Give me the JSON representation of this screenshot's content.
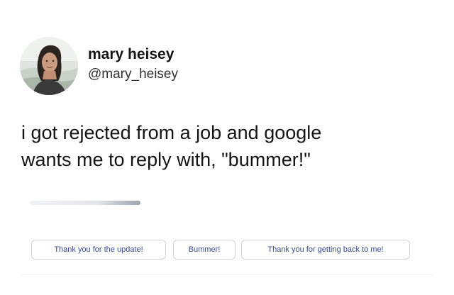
{
  "tweet": {
    "author": {
      "display_name": "mary heisey",
      "handle": "@mary_heisey",
      "avatar_icon": "profile-photo"
    },
    "text_lines": [
      "i got rejected from a job and google",
      "wants me to reply with, \"bummer!\""
    ]
  },
  "smart_replies": [
    {
      "label": "Thank you for the update!"
    },
    {
      "label": "Bummer!"
    },
    {
      "label": "Thank you for getting back to me!"
    }
  ],
  "colors": {
    "chip_text": "#3a4a8c",
    "chip_border": "#cfd3d8",
    "text": "#141414"
  }
}
